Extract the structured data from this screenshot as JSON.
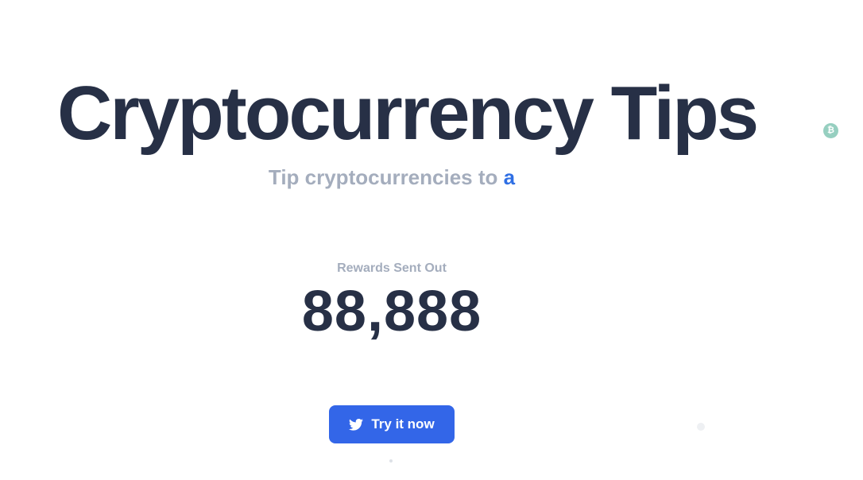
{
  "hero": {
    "title": "Cryptocurrency Tips",
    "subtitle_prefix": "Tip cryptocurrencies to ",
    "subtitle_typed": "a"
  },
  "stats": {
    "label": "Rewards Sent Out",
    "value": "88,888"
  },
  "cta": {
    "label": "Try it now",
    "icon": "twitter-icon"
  },
  "decorations": {
    "coin_icon": "bitcoin-coin-icon",
    "coin_glyph": "₿"
  },
  "colors": {
    "title": "#273046",
    "muted": "#a4adbd",
    "accent": "#2f6fe4",
    "button": "#3366e8",
    "coin": "#96cfc0"
  }
}
